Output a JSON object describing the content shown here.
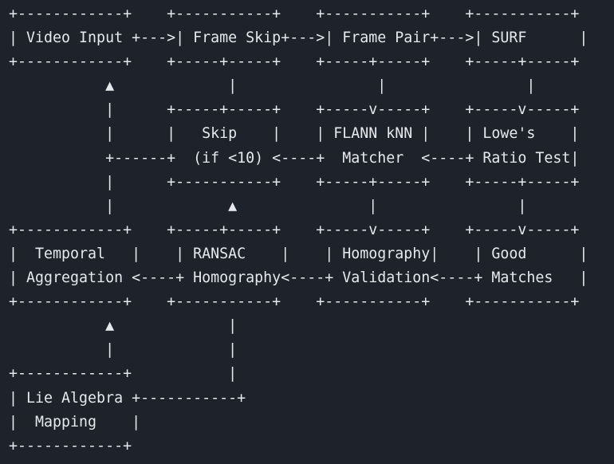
{
  "diagram": {
    "lines": [
      "+------------+    +-----------+    +-----------+    +-----------+",
      "| Video Input +--->| Frame Skip+--->| Frame Pair+--->| SURF      |",
      "+------------+    +-----+-----+    +-----+-----+    +-----+-----+",
      "           ▲             |                |                |",
      "           |      +-----+-----+    +-----v-----+    +-----v-----+",
      "           |      |   Skip    |    | FLANN kNN |    | Lowe's    |",
      "           +------+  (if <10) <----+  Matcher  <----+ Ratio Test|",
      "           |      +-----------+    +-----+-----+    +-----+-----+",
      "           |             ▲               |                |",
      "+------------+    +-----+-----+    +-----v-----+    +-----v-----+",
      "|  Temporal   |    | RANSAC    |    | Homography|    | Good      |",
      "| Aggregation <----+ Homography<----+ Validation<----+ Matches   |",
      "+------------+    +-----------+    +-----------+    +-----------+",
      "           ▲             |",
      "           |             |",
      "+------------+           |",
      "| Lie Algebra +-----------+",
      "|  Mapping    |",
      "+------------+"
    ]
  }
}
